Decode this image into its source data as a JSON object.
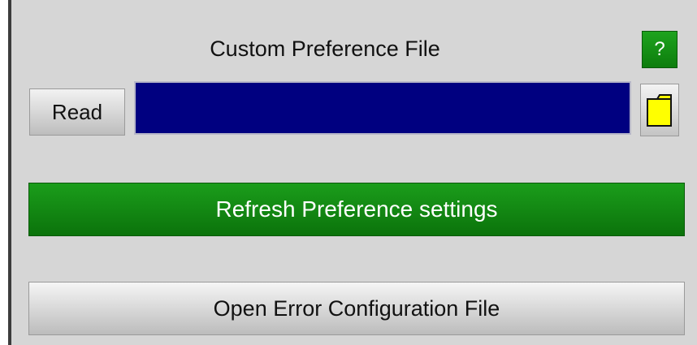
{
  "panel": {
    "heading": "Custom Preference File",
    "help_label": "?",
    "read_label": "Read",
    "path_value": "",
    "refresh_label": "Refresh Preference settings",
    "error_config_label": "Open Error Configuration File"
  },
  "icons": {
    "folder": "folder-icon"
  },
  "colors": {
    "panel_bg": "#d6d6d6",
    "green_button": "#138b13",
    "path_field": "#000080",
    "folder_fill": "#ffff00"
  }
}
